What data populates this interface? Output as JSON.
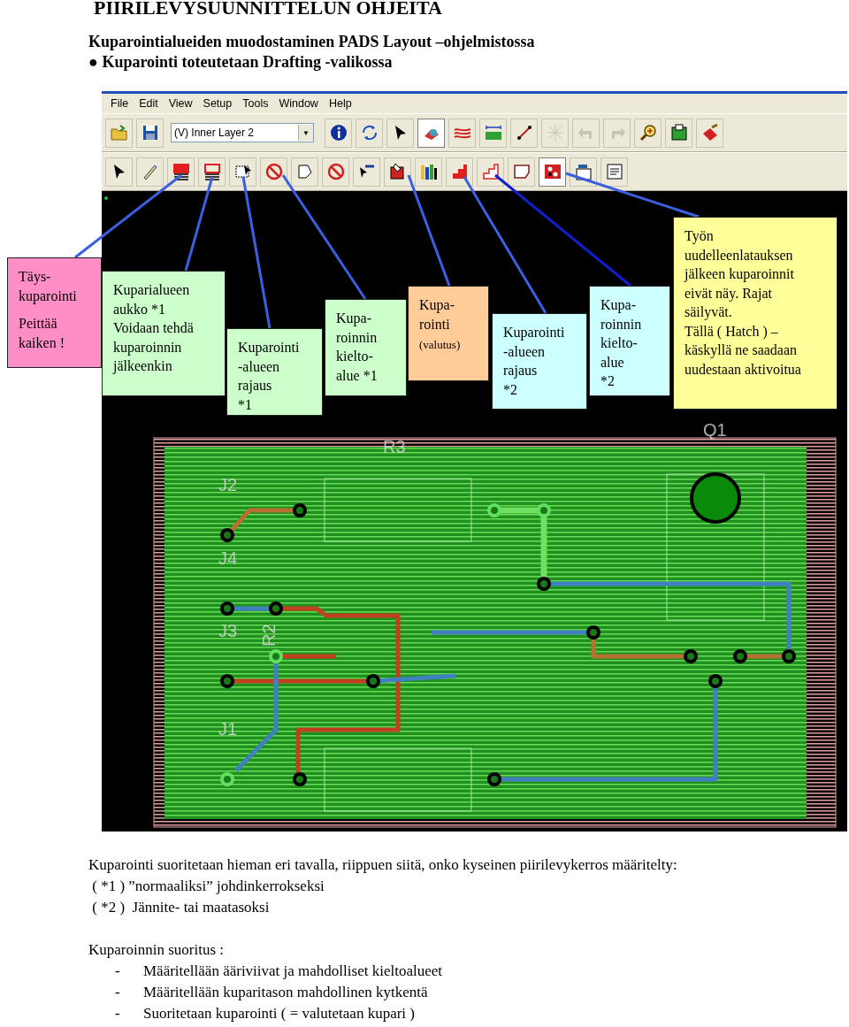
{
  "title": "PIIRILEVYSUUNNITTELUN OHJEITA",
  "subtitle": "Kuparointialueiden muodostaminen PADS Layout –ohjelmistossa",
  "bullet": {
    "mark": "●",
    "text": "Kuparointi toteutetaan Drafting -valikossa"
  },
  "app": {
    "menu": [
      "File",
      "Edit",
      "View",
      "Setup",
      "Tools",
      "Window",
      "Help"
    ],
    "layer_dropdown": {
      "value": "(V) Inner Layer 2",
      "arrow": "▼"
    },
    "toolbar_1": [
      {
        "pressed": false,
        "disabled": false
      },
      {
        "pressed": false,
        "disabled": false
      },
      {
        "pressed": false,
        "disabled": false
      },
      {
        "pressed": false,
        "disabled": false
      },
      {
        "pressed": false,
        "disabled": false
      },
      {
        "pressed": true,
        "disabled": false
      },
      {
        "pressed": false,
        "disabled": false
      },
      {
        "pressed": false,
        "disabled": false
      },
      {
        "pressed": false,
        "disabled": false
      },
      {
        "pressed": false,
        "disabled": true
      },
      {
        "pressed": false,
        "disabled": true
      },
      {
        "pressed": false,
        "disabled": true
      },
      {
        "pressed": false,
        "disabled": false
      },
      {
        "pressed": false,
        "disabled": false
      },
      {
        "pressed": false,
        "disabled": false
      }
    ],
    "toolbar_2": [
      {
        "pressed": false
      },
      {
        "pressed": false
      },
      {
        "pressed": false
      },
      {
        "pressed": false
      },
      {
        "pressed": false
      },
      {
        "pressed": false
      },
      {
        "pressed": false
      },
      {
        "pressed": false
      },
      {
        "pressed": false
      },
      {
        "pressed": false
      },
      {
        "pressed": false
      },
      {
        "pressed": false
      },
      {
        "pressed": false
      },
      {
        "pressed": false
      },
      {
        "pressed": true
      },
      {
        "pressed": false
      },
      {
        "pressed": false
      }
    ],
    "board_labels": [
      {
        "text": "R3",
        "kind": "flat"
      },
      {
        "text": "Q1",
        "kind": "flat"
      },
      {
        "text": "J2",
        "kind": "flat"
      },
      {
        "text": "J4",
        "kind": "flat"
      },
      {
        "text": "J3",
        "kind": "flat"
      },
      {
        "text": "R2",
        "kind": "rotated"
      },
      {
        "text": "J1",
        "kind": "flat"
      }
    ]
  },
  "callouts": [
    {
      "color": "#ff8ec6",
      "paragraphs": [
        "Täys-\nkuparointi",
        "Peittää\nkaiken !"
      ]
    },
    {
      "color": "#ccffcc",
      "paragraphs": [
        "Kuparialueen\naukko *1\nVoidaan tehdä\nkuparoinnin\njälkeenkin"
      ]
    },
    {
      "color": "#ccffcc",
      "paragraphs": [
        "Kuparointi\n-alueen\nrajaus\n*1"
      ]
    },
    {
      "color": "#ccffcc",
      "paragraphs": [
        "Kupa-\nroinnin\nkielto-\nalue *1"
      ]
    },
    {
      "color": "#ffcc99",
      "paragraphs": [
        "Kupa-\nrointi"
      ],
      "note": "(valutus)"
    },
    {
      "color": "#ccffff",
      "paragraphs": [
        "Kuparointi\n-alueen\nrajaus\n*2"
      ]
    },
    {
      "color": "#ccffff",
      "paragraphs": [
        "Kupa-\nroinnin\nkielto-\nalue\n*2"
      ]
    },
    {
      "color": "#ffff99",
      "paragraphs": [
        "Työn\nuudelleenlatauksen\njälkeen kuparoinnit\neivät näy. Rajat\nsäilyvät.\nTällä ( Hatch ) –\nkäskyllä ne saadaan\nuudestaan aktivoitua"
      ]
    }
  ],
  "notes": [
    "Kuparointi suoritetaan hieman eri tavalla, riippuen siitä, onko kyseinen piirilevykerros määritelty:",
    " ( *1 ) ”normaaliksi” johdinkerrokseksi",
    " ( *2 )  Jännite- tai maatasoksi"
  ],
  "steps_heading": "Kuparoinnin suoritus :",
  "steps": [
    {
      "mark": "-",
      "text": "Määritellään ääriviivat ja mahdolliset kieltoalueet"
    },
    {
      "mark": "-",
      "text": "Määritellään kuparitason mahdollinen kytkentä"
    },
    {
      "mark": "-",
      "text": "Suoritetaan kuparointi ( = valutetaan kupari )"
    }
  ]
}
